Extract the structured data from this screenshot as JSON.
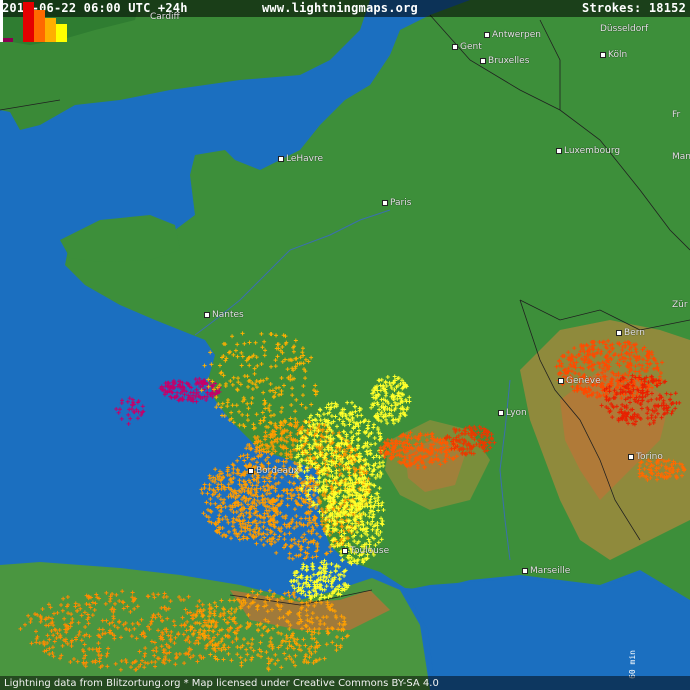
{
  "header": {
    "datetime": "2014-06-22 06:00 UTC +24h",
    "site": "www.lightningmaps.org",
    "strokes": "Strokes: 18152"
  },
  "footer": {
    "credit": "Lightning data from Blitzortung.org  *  Map licensed under Creative Commons BY-SA 4.0"
  },
  "cities": {
    "cardiff": "Cardiff",
    "antwerpen": "Antwerpen",
    "gent": "Gent",
    "bruxelles": "Bruxelles",
    "dusseldorf": "Düsseldorf",
    "koln": "Köln",
    "luxembourg": "Luxembourg",
    "lehavre": "LeHavre",
    "paris": "Paris",
    "frankfurt": "Fr",
    "mannheim": "Man",
    "nantes": "Nantes",
    "zurich": "Zür",
    "bern": "Bern",
    "geneve": "Genève",
    "lyon": "Lyon",
    "bordeaux": "Bordeaux",
    "torino": "Torino",
    "toulouse": "Toulouse",
    "marseille": "Marseille"
  },
  "legend": {
    "label": "60 min",
    "colors": [
      "#8b0050",
      "#e40000",
      "#ff6a00",
      "#ffb000",
      "#ffff00"
    ]
  },
  "colors": {
    "sea": "#1b6fc0",
    "land": "#3d8f3a",
    "uk_land": "#3a8a37",
    "high_terrain": "#b87a3a",
    "strike_recent": "#ffff2a",
    "strike_older": "#ff9c00",
    "strike_oldest": "#c4006a"
  }
}
